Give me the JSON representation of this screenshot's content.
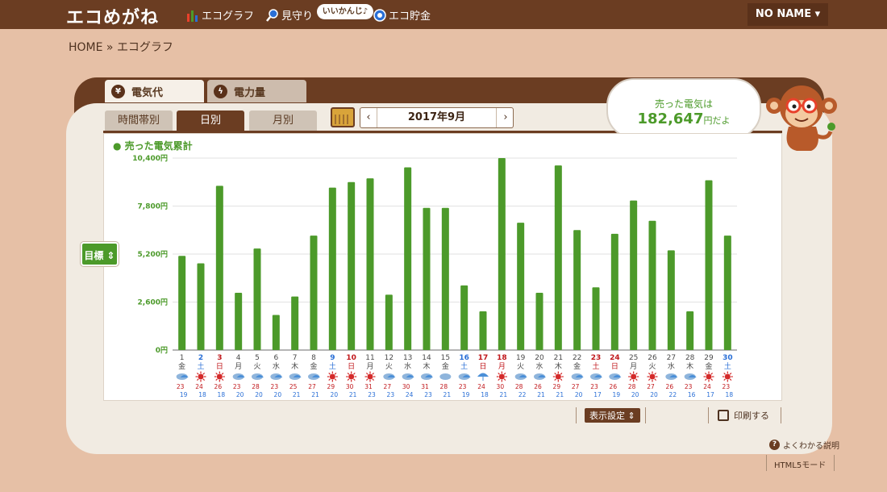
{
  "header": {
    "logo": "エコめがね",
    "nav": [
      {
        "label": "エコグラフ",
        "icon": "bar-graph-icon"
      },
      {
        "label": "見守り",
        "icon": "watch-magnifier-icon"
      },
      {
        "label": "エコ貯金",
        "icon": "piggy-coin-icon"
      }
    ],
    "balloon": "いいかんじ♪",
    "user": "NO NAME ▾"
  },
  "breadcrumb": "HOME » エコグラフ",
  "tabs": {
    "category": [
      {
        "label": "電気代",
        "icon": "yen-icon",
        "active": true
      },
      {
        "label": "電力量",
        "icon": "lightning-icon",
        "active": false
      }
    ],
    "period": [
      {
        "label": "時間帯別",
        "active": false
      },
      {
        "label": "日別",
        "active": true
      },
      {
        "label": "月別",
        "active": false
      }
    ]
  },
  "date_nav": {
    "prev": "‹",
    "date": "2017年9月",
    "next": "›"
  },
  "bubble": {
    "line1": "売った電気は",
    "amount": "182,647",
    "suffix": "円だよ"
  },
  "goal_button": "目標 ⇕",
  "display_settings": "表示設定 ⇕",
  "print": "印刷する",
  "help": "よくわかる説明",
  "html5_mode": "HTML5モード",
  "colors": {
    "bar": "#4c9a2a",
    "brown": "#6b3d22",
    "sat": "#2a6fd6",
    "sun": "#c0171b"
  },
  "chart_data": {
    "type": "bar",
    "title": "売った電気累計",
    "ylabel": "",
    "ylim": [
      0,
      10400
    ],
    "yticks": [
      "0円",
      "2,600円",
      "5,200円",
      "7,800円",
      "10,400円"
    ],
    "days": [
      {
        "d": "1",
        "w": "金",
        "k": "n",
        "v": 5100,
        "wx": "cloud-rain",
        "hi": "23",
        "lo": "19"
      },
      {
        "d": "2",
        "w": "土",
        "k": "sat",
        "v": 4700,
        "wx": "sun",
        "hi": "24",
        "lo": "18"
      },
      {
        "d": "3",
        "w": "日",
        "k": "sun",
        "v": 8900,
        "wx": "sun",
        "hi": "26",
        "lo": "18"
      },
      {
        "d": "4",
        "w": "月",
        "k": "n",
        "v": 3100,
        "wx": "cloud-rain",
        "hi": "23",
        "lo": "20"
      },
      {
        "d": "5",
        "w": "火",
        "k": "n",
        "v": 5500,
        "wx": "cloud-rain",
        "hi": "28",
        "lo": "20"
      },
      {
        "d": "6",
        "w": "水",
        "k": "n",
        "v": 1900,
        "wx": "cloud-rain",
        "hi": "23",
        "lo": "20"
      },
      {
        "d": "7",
        "w": "木",
        "k": "n",
        "v": 2900,
        "wx": "cloud-rain",
        "hi": "25",
        "lo": "21"
      },
      {
        "d": "8",
        "w": "金",
        "k": "n",
        "v": 6200,
        "wx": "cloud-rain",
        "hi": "27",
        "lo": "21"
      },
      {
        "d": "9",
        "w": "土",
        "k": "sat",
        "v": 8800,
        "wx": "sun",
        "hi": "29",
        "lo": "20"
      },
      {
        "d": "10",
        "w": "日",
        "k": "sun",
        "v": 9100,
        "wx": "sun",
        "hi": "30",
        "lo": "21"
      },
      {
        "d": "11",
        "w": "月",
        "k": "n",
        "v": 9300,
        "wx": "sun",
        "hi": "31",
        "lo": "23"
      },
      {
        "d": "12",
        "w": "火",
        "k": "n",
        "v": 3000,
        "wx": "cloud-rain",
        "hi": "27",
        "lo": "23"
      },
      {
        "d": "13",
        "w": "水",
        "k": "n",
        "v": 9900,
        "wx": "cloud-rain",
        "hi": "30",
        "lo": "24"
      },
      {
        "d": "14",
        "w": "木",
        "k": "n",
        "v": 7700,
        "wx": "cloud-rain",
        "hi": "31",
        "lo": "23"
      },
      {
        "d": "15",
        "w": "金",
        "k": "n",
        "v": 7700,
        "wx": "cloud",
        "hi": "28",
        "lo": "21"
      },
      {
        "d": "16",
        "w": "土",
        "k": "sat",
        "v": 3500,
        "wx": "cloud-rain",
        "hi": "23",
        "lo": "19"
      },
      {
        "d": "17",
        "w": "日",
        "k": "sun",
        "v": 2100,
        "wx": "rain",
        "hi": "24",
        "lo": "18"
      },
      {
        "d": "18",
        "w": "月",
        "k": "sun",
        "v": 10400,
        "wx": "sun",
        "hi": "30",
        "lo": "21"
      },
      {
        "d": "19",
        "w": "火",
        "k": "n",
        "v": 6900,
        "wx": "cloud-rain",
        "hi": "28",
        "lo": "22"
      },
      {
        "d": "20",
        "w": "水",
        "k": "n",
        "v": 3100,
        "wx": "cloud-rain",
        "hi": "26",
        "lo": "21"
      },
      {
        "d": "21",
        "w": "木",
        "k": "n",
        "v": 10000,
        "wx": "sun",
        "hi": "29",
        "lo": "21"
      },
      {
        "d": "22",
        "w": "金",
        "k": "n",
        "v": 6500,
        "wx": "cloud-rain",
        "hi": "27",
        "lo": "20"
      },
      {
        "d": "23",
        "w": "土",
        "k": "sun",
        "v": 3400,
        "wx": "cloud-rain",
        "hi": "23",
        "lo": "17"
      },
      {
        "d": "24",
        "w": "日",
        "k": "sun",
        "v": 6300,
        "wx": "cloud-rain",
        "hi": "26",
        "lo": "19"
      },
      {
        "d": "25",
        "w": "月",
        "k": "n",
        "v": 8100,
        "wx": "sun",
        "hi": "28",
        "lo": "20"
      },
      {
        "d": "26",
        "w": "火",
        "k": "n",
        "v": 7000,
        "wx": "sun",
        "hi": "27",
        "lo": "20"
      },
      {
        "d": "27",
        "w": "水",
        "k": "n",
        "v": 5400,
        "wx": "cloud-rain",
        "hi": "26",
        "lo": "22"
      },
      {
        "d": "28",
        "w": "木",
        "k": "n",
        "v": 2100,
        "wx": "cloud-rain",
        "hi": "23",
        "lo": "16"
      },
      {
        "d": "29",
        "w": "金",
        "k": "n",
        "v": 9200,
        "wx": "sun",
        "hi": "24",
        "lo": "17"
      },
      {
        "d": "30",
        "w": "土",
        "k": "sat",
        "v": 6200,
        "wx": "sun",
        "hi": "23",
        "lo": "18"
      }
    ]
  }
}
